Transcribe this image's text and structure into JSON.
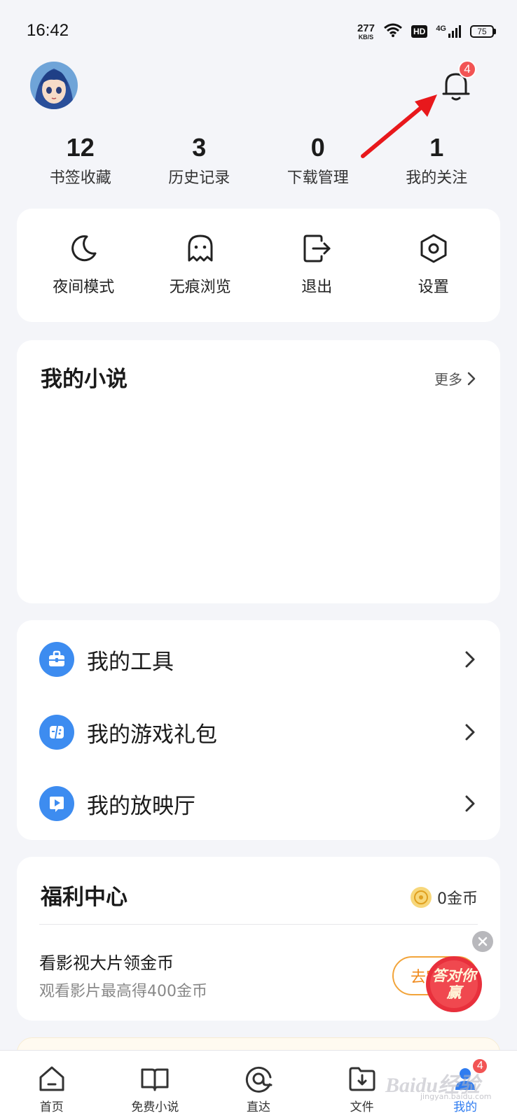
{
  "status_bar": {
    "time": "16:42",
    "net_speed_value": "277",
    "net_speed_unit": "KB/S",
    "hd_label": "HD",
    "network_label": "4G",
    "battery": "75"
  },
  "header": {
    "notification_count": "4"
  },
  "stats": [
    {
      "value": "12",
      "label": "书签收藏"
    },
    {
      "value": "3",
      "label": "历史记录"
    },
    {
      "value": "0",
      "label": "下载管理"
    },
    {
      "value": "1",
      "label": "我的关注"
    }
  ],
  "quick_actions": [
    {
      "label": "夜间模式",
      "icon": "moon-icon"
    },
    {
      "label": "无痕浏览",
      "icon": "ghost-icon"
    },
    {
      "label": "退出",
      "icon": "logout-icon"
    },
    {
      "label": "设置",
      "icon": "settings-hexagon-icon"
    }
  ],
  "novels": {
    "title": "我的小说",
    "more_label": "更多"
  },
  "tools": [
    {
      "label": "我的工具",
      "icon": "toolbox-icon"
    },
    {
      "label": "我的游戏礼包",
      "icon": "game-gift-icon"
    },
    {
      "label": "我的放映厅",
      "icon": "play-icon"
    }
  ],
  "welfare": {
    "title": "福利中心",
    "coins_label": "0金币",
    "task_title": "看影视大片领金币",
    "task_subtitle": "观看影片最高得400金币",
    "go_label": "去完成",
    "promo_text": "答对你赢"
  },
  "bottom_nav": [
    {
      "label": "首页",
      "icon": "home-icon"
    },
    {
      "label": "免费小说",
      "icon": "book-icon"
    },
    {
      "label": "直达",
      "icon": "direct-icon"
    },
    {
      "label": "文件",
      "icon": "download-folder-icon"
    },
    {
      "label": "我的",
      "icon": "profile-icon",
      "badge": "4"
    }
  ],
  "watermark": {
    "text": "Baidu经验",
    "sub": "jingyan.baidu.com"
  },
  "colors": {
    "accent_blue": "#3d8cf0",
    "badge_red": "#f25454",
    "annotation_red": "#e8181c",
    "go_orange": "#f2a43a"
  }
}
